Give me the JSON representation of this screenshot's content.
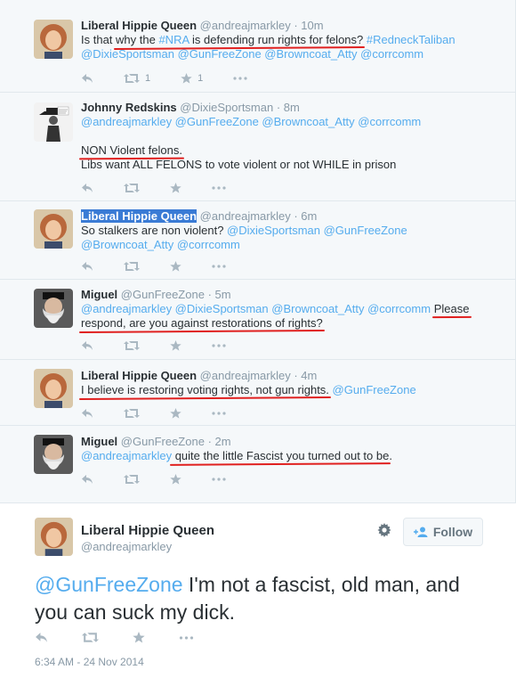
{
  "tweets": [
    {
      "name": "Liberal Hippie Queen",
      "handle": "@andreajmarkley",
      "time": "· 10m",
      "line1": {
        "a": "Is that ",
        "b": "why the ",
        "c": "#NRA",
        "d": " is defending run rights for felons?",
        "e": " #RedneckTaliban"
      },
      "line2": "@DixieSportsman @GunFreeZone @Browncoat_Atty @corrcomm",
      "retweets": "1",
      "favorites": "1"
    },
    {
      "name": "Johnny Redskins",
      "handle": "@DixieSportsman",
      "time": "· 8m",
      "line1": "@andreajmarkley @GunFreeZone @Browncoat_Atty @corrcomm",
      "line2": "NON Violent felons.",
      "line3": "Libs want ALL FELONS to vote violent or not WHILE in prison"
    },
    {
      "name": "Liberal Hippie Queen",
      "handle": "@andreajmarkley",
      "time": "· 6m",
      "line1": {
        "a": "So stalkers are non violent? ",
        "b": "@DixieSportsman @GunFreeZone"
      },
      "line2": "@Browncoat_Atty @corrcomm"
    },
    {
      "name": "Miguel",
      "handle": "@GunFreeZone",
      "time": "· 5m",
      "line1": {
        "a": "@andreajmarkley @DixieSportsman @Browncoat_Atty @corrcomm ",
        "b": "Please"
      },
      "line2": "respond, are you against restorations of rights?"
    },
    {
      "name": "Liberal Hippie Queen",
      "handle": "@andreajmarkley",
      "time": "· 4m",
      "line1": {
        "a": "I believe is restoring voting rights, not gun rights.",
        "b": " @GunFreeZone"
      }
    },
    {
      "name": "Miguel",
      "handle": "@GunFreeZone",
      "time": "· 2m",
      "line1": {
        "a": "@andreajmarkley",
        "b": " quite the little Fascist you turned out to be",
        "c": "."
      }
    }
  ],
  "main": {
    "name": "Liberal Hippie Queen",
    "handle": "@andreajmarkley",
    "follow_label": "Follow",
    "text_mention": "@GunFreeZone",
    "text_body": " I'm not a fascist, old man, and you can suck my dick.",
    "timestamp": "6:34 AM - 24 Nov 2014"
  },
  "colors": {
    "link": "#55acee",
    "underline": "#e0201f",
    "selection": "#3a7bd5"
  },
  "icons": [
    "reply-icon",
    "retweet-icon",
    "favorite-star-icon",
    "more-icon",
    "gear-icon",
    "follow-person-icon"
  ]
}
